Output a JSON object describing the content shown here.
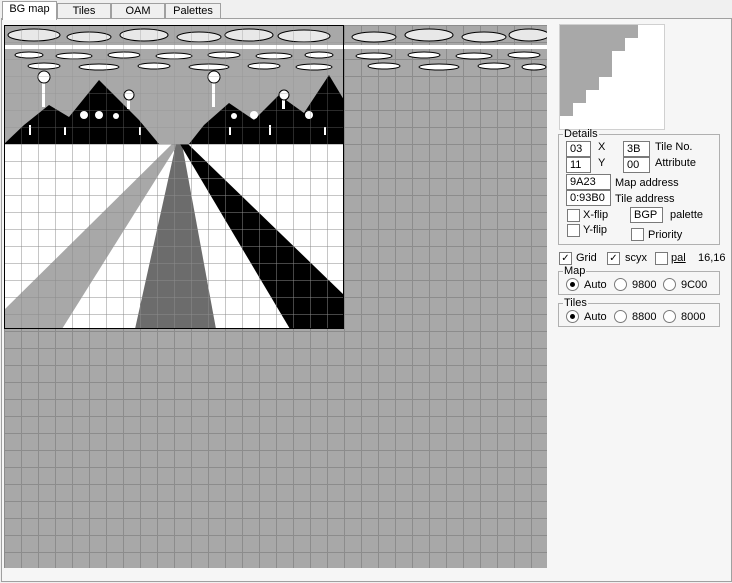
{
  "tabs": [
    {
      "label": "BG map",
      "active": true
    },
    {
      "label": "Tiles",
      "active": false
    },
    {
      "label": "OAM",
      "active": false
    },
    {
      "label": "Palettes",
      "active": false
    }
  ],
  "details": {
    "legend": "Details",
    "x_value": "03",
    "x_label": "X",
    "y_value": "11",
    "y_label": "Y",
    "tile_no_value": "3B",
    "tile_no_label": "Tile No.",
    "attribute_value": "00",
    "attribute_label": "Attribute",
    "map_address_value": "9A23",
    "map_address_label": "Map address",
    "tile_address_value": "0:93B0",
    "tile_address_label": "Tile address",
    "xflip_label": "X-flip",
    "xflip_checked": false,
    "yflip_label": "Y-flip",
    "yflip_checked": false,
    "palette_value": "BGP",
    "palette_label": "palette",
    "priority_label": "Priority",
    "priority_checked": false
  },
  "options": {
    "grid_label": "Grid",
    "grid_checked": true,
    "scyx_label": "scyx",
    "scyx_checked": true,
    "pal_label": "pal",
    "pal_checked": false,
    "zoom_readout": "16,16"
  },
  "map_group": {
    "legend": "Map",
    "options": [
      "Auto",
      "9800",
      "9C00"
    ],
    "selected": "Auto"
  },
  "tiles_group": {
    "legend": "Tiles",
    "options": [
      "Auto",
      "8800",
      "8000"
    ],
    "selected": "Auto"
  },
  "colors": {
    "shade_white": "#ffffff",
    "shade_light": "#a8a8a8",
    "shade_dark": "#6c6c6c",
    "shade_black": "#000000",
    "grid_line": "#8c8c8c"
  }
}
